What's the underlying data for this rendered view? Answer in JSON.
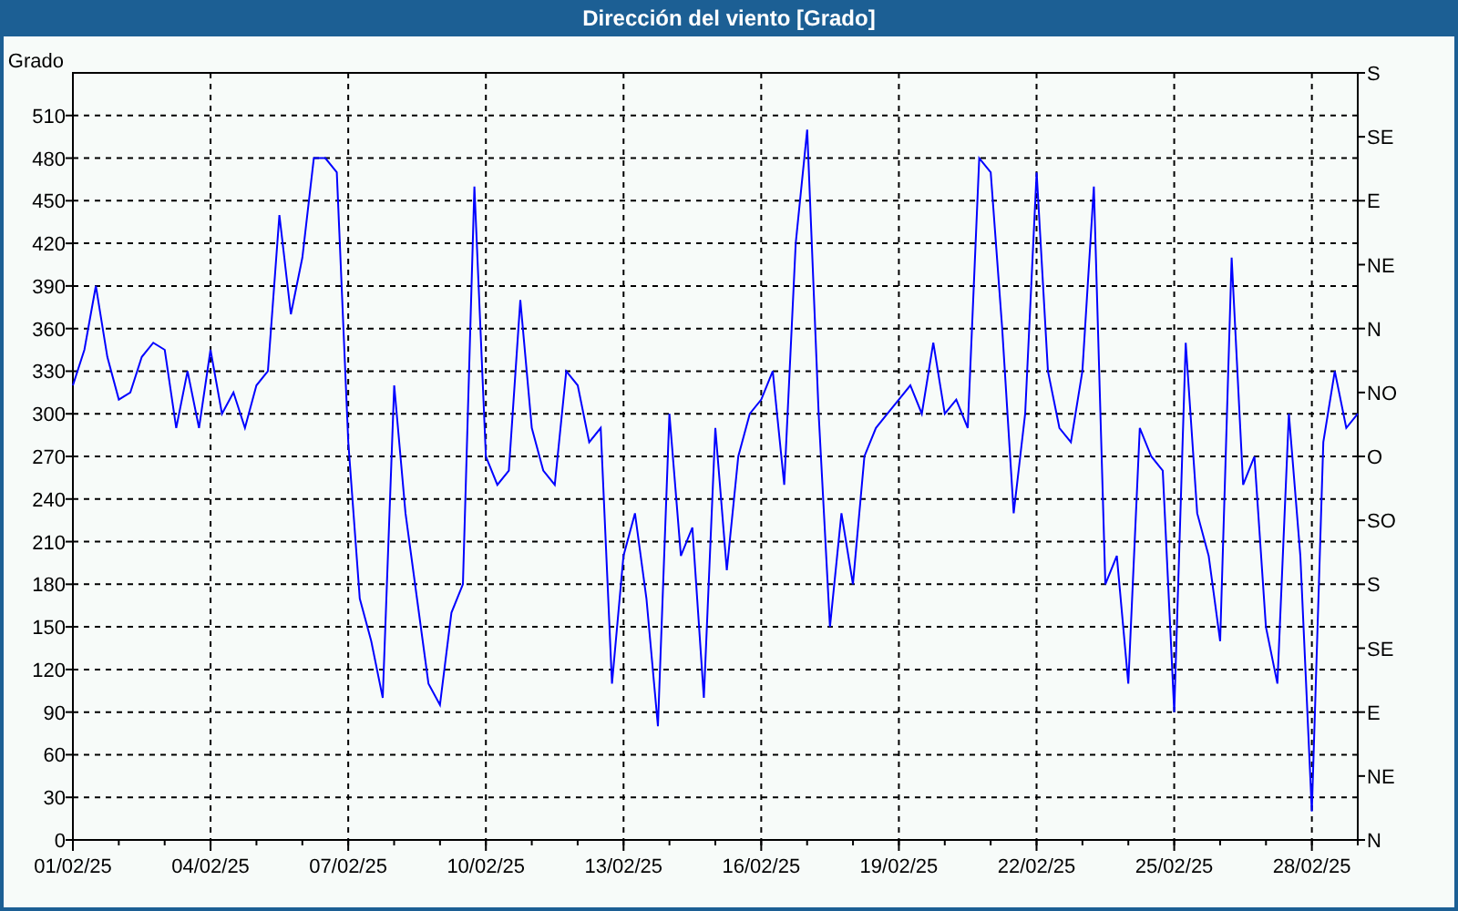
{
  "window": {
    "title": "Dirección del viento [Grado]"
  },
  "chart": {
    "right_axis_labels": [
      "S",
      "SE",
      "E",
      "NE",
      "N",
      "NO",
      "O",
      "SO",
      "S",
      "SE",
      "E",
      "NE",
      "N"
    ],
    "chart_data": {
      "type": "line",
      "ylabel": "Grado",
      "grid": true,
      "ylim": [
        0,
        540
      ],
      "categories": [
        "01/02/25",
        null,
        null,
        null,
        null,
        null,
        null,
        null,
        null,
        null,
        null,
        null,
        "04/02/25",
        null,
        null,
        null,
        null,
        null,
        null,
        null,
        null,
        null,
        null,
        null,
        "07/02/25",
        null,
        null,
        null,
        null,
        null,
        null,
        null,
        null,
        null,
        null,
        null,
        "10/02/25",
        null,
        null,
        null,
        null,
        null,
        null,
        null,
        null,
        null,
        null,
        null,
        "13/02/25",
        null,
        null,
        null,
        null,
        null,
        null,
        null,
        null,
        null,
        null,
        null,
        "16/02/25",
        null,
        null,
        null,
        null,
        null,
        null,
        null,
        null,
        null,
        null,
        null,
        "19/02/25",
        null,
        null,
        null,
        null,
        null,
        null,
        null,
        null,
        null,
        null,
        null,
        "22/02/25",
        null,
        null,
        null,
        null,
        null,
        null,
        null,
        null,
        null,
        null,
        null,
        "25/02/25",
        null,
        null,
        null,
        null,
        null,
        null,
        null,
        null,
        null,
        null,
        null,
        "28/02/25",
        null,
        null,
        null,
        null
      ],
      "yticks": [
        0,
        30,
        60,
        90,
        120,
        150,
        180,
        210,
        240,
        270,
        300,
        330,
        360,
        390,
        420,
        450,
        480,
        510
      ],
      "series": [
        {
          "color": "#0000ff",
          "values": [
            320,
            345,
            390,
            340,
            310,
            315,
            340,
            350,
            345,
            290,
            330,
            290,
            345,
            300,
            315,
            290,
            320,
            330,
            440,
            370,
            410,
            480,
            480,
            470,
            280,
            170,
            140,
            100,
            320,
            230,
            170,
            110,
            95,
            160,
            180,
            460,
            270,
            250,
            260,
            380,
            290,
            260,
            250,
            330,
            320,
            280,
            290,
            110,
            200,
            230,
            170,
            80,
            300,
            200,
            220,
            100,
            290,
            190,
            270,
            300,
            310,
            330,
            250,
            420,
            500,
            300,
            150,
            230,
            180,
            270,
            290,
            300,
            310,
            320,
            300,
            350,
            300,
            310,
            290,
            480,
            470,
            360,
            230,
            300,
            470,
            330,
            290,
            280,
            330,
            460,
            180,
            200,
            110,
            290,
            270,
            260,
            90,
            350,
            230,
            200,
            140,
            410,
            250,
            270,
            150,
            110,
            300,
            200,
            20,
            280,
            330,
            290,
            300
          ]
        }
      ]
    }
  }
}
